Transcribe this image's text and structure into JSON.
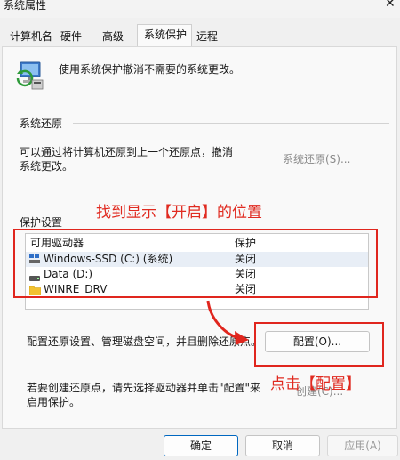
{
  "window": {
    "title": "系统属性"
  },
  "tabs": [
    {
      "label": "计算机名"
    },
    {
      "label": "硬件"
    },
    {
      "label": "高级"
    },
    {
      "label": "系统保护"
    },
    {
      "label": "远程"
    }
  ],
  "intro": {
    "text": "使用系统保护撤消不需要的系统更改。"
  },
  "restore": {
    "heading": "系统还原",
    "desc_line1": "可以通过将计算机还原到上一个还原点，撤消",
    "desc_line2": "系统更改。",
    "button": "系统还原(S)..."
  },
  "protection": {
    "heading": "保护设置",
    "columns": [
      "可用驱动器",
      "保护"
    ],
    "drives": [
      {
        "name": "Windows-SSD (C:) (系统)",
        "status": "关闭",
        "icon": "system-drive-icon"
      },
      {
        "name": "Data (D:)",
        "status": "关闭",
        "icon": "drive-icon"
      },
      {
        "name": "WINRE_DRV",
        "status": "关闭",
        "icon": "folder-icon"
      }
    ],
    "configure_text": "配置还原设置、管理磁盘空间，并且删除还原点。",
    "configure_button": "配置(O)...",
    "create_line1": "若要创建还原点，请先选择驱动器并单击\"配置\"来",
    "create_line2": "启用保护。",
    "create_button": "创建(C)..."
  },
  "footer": {
    "ok": "确定",
    "cancel": "取消",
    "apply": "应用(A)"
  },
  "annotations": {
    "find_label": "找到显示【开启】的位置",
    "click_label": "点击【配置】",
    "color": "#e0261e"
  }
}
